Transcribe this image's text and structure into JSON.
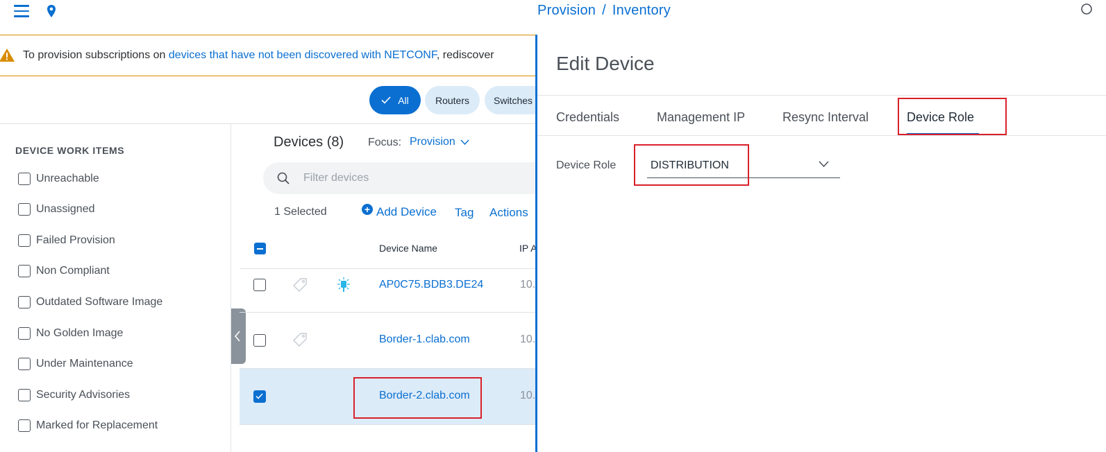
{
  "header": {
    "breadcrumb": [
      "Provision",
      "Inventory"
    ],
    "separator": "/"
  },
  "banner": {
    "prefix": "To provision subscriptions on ",
    "link": "devices that have not been discovered with NETCONF",
    "suffix": ", rediscover"
  },
  "filters": {
    "chips": [
      "All",
      "Routers",
      "Switches"
    ],
    "active": "All"
  },
  "sidebar": {
    "title": "DEVICE WORK ITEMS",
    "items": [
      "Unreachable",
      "Unassigned",
      "Failed Provision",
      "Non Compliant",
      "Outdated Software Image",
      "No Golden Image",
      "Under Maintenance",
      "Security Advisories",
      "Marked for Replacement"
    ]
  },
  "devices": {
    "title": "Devices (8)",
    "focus_label": "Focus:",
    "focus_value": "Provision",
    "filter_placeholder": "Filter devices",
    "selected_text": "1 Selected",
    "add_device": "Add Device",
    "tag": "Tag",
    "actions": "Actions",
    "columns": [
      "Device Name",
      "IP A"
    ],
    "rows": [
      {
        "name": "AP0C75.BDB3.DE24",
        "ip": "10.",
        "checked": false
      },
      {
        "name": "Border-1.clab.com",
        "ip": "10.",
        "checked": false
      },
      {
        "name": "Border-2.clab.com",
        "ip": "10.",
        "checked": true
      }
    ]
  },
  "drawer": {
    "title": "Edit Device",
    "tabs": [
      "Credentials",
      "Management IP",
      "Resync Interval",
      "Device Role"
    ],
    "active_tab": "Device Role",
    "field_label": "Device Role",
    "field_value": "DISTRIBUTION"
  },
  "colors": {
    "accent": "#0a6fd1",
    "warning": "#d98c00",
    "highlight": "#d9202a",
    "selected_row": "#dcebf8"
  }
}
